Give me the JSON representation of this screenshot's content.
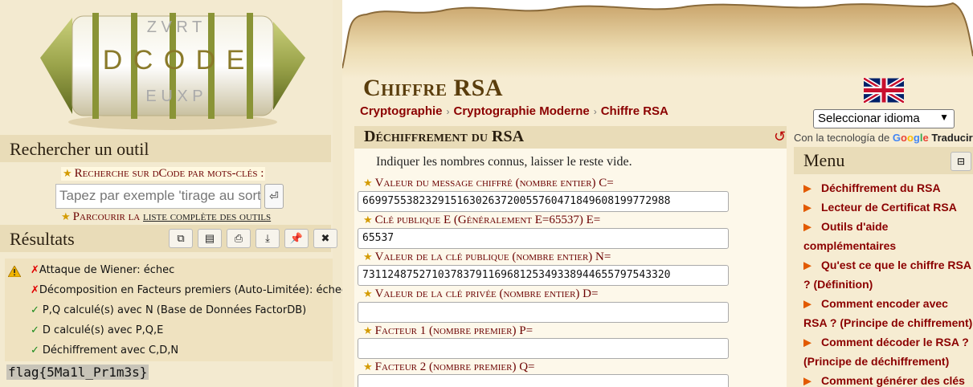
{
  "logo": {
    "letters_row1": "Z V R T",
    "letters_row2": "D C O D E",
    "letters_row3": "E U X P"
  },
  "left": {
    "search_title": "Rechercher un outil",
    "keyword_search": "Recherche sur dCode par mots-clés :",
    "search_placeholder": "Tapez par exemple 'tirage au sort'",
    "search_button": "⏎",
    "browse_prefix": "Parcourir la ",
    "browse_link": "liste complète des outils",
    "results_title": "Résultats",
    "results": [
      {
        "mark": "✗",
        "text": "Attaque de Wiener: échec"
      },
      {
        "mark": "✗",
        "text": "Décomposition en Facteurs premiers (Auto-Limitée): échec"
      },
      {
        "mark": "✓",
        "text": "P,Q calculé(s) avec N (Base de Données FactorDB)"
      },
      {
        "mark": "✓",
        "text": "D calculé(s) avec P,Q,E"
      },
      {
        "mark": "✓",
        "text": "Déchiffrement avec C,D,N"
      }
    ],
    "flag_output": "flag{5Ma1l_Pr1m3s}",
    "tool_icons": [
      "copy-icon",
      "save-icon",
      "print-icon",
      "download-icon",
      "pin-icon",
      "close-icon"
    ]
  },
  "main": {
    "title": "Chiffre RSA",
    "breadcrumb": [
      "Cryptographie",
      "Cryptographie Moderne",
      "Chiffre RSA"
    ],
    "panel_title": "Déchiffrement du RSA",
    "intro": "Indiquer les nombres connus, laisser le reste vide.",
    "fields": [
      {
        "label": "Valeur du message chiffré (nombre entier) C=",
        "value": "6699755382329151630263720055760471849608199772988"
      },
      {
        "label": "Clé publique E (Généralement E=65537) E=",
        "value": "65537"
      },
      {
        "label": "Valeur de la clé publique (nombre entier) N=",
        "value": "7311248752710378379116968125349338944655797543320"
      },
      {
        "label": "Valeur de la clé privée (nombre entier) D=",
        "value": ""
      },
      {
        "label": "Facteur 1 (nombre premier) P=",
        "value": ""
      },
      {
        "label": "Facteur 2 (nombre premier) Q=",
        "value": ""
      }
    ]
  },
  "right": {
    "language_select": "Seleccionar idioma",
    "powered_by": "Con la tecnología de",
    "google_letters": [
      "G",
      "o",
      "o",
      "g",
      "l",
      "e"
    ],
    "translate": "Traducir",
    "menu_title": "Menu",
    "menu_toggle": "⊟",
    "menu_items": [
      "Déchiffrement du RSA",
      "Lecteur de Certificat RSA",
      "Outils d'aide complémentaires",
      "Qu'est ce que le chiffre RSA ? (Définition)",
      "Comment encoder avec RSA ? (Principe de chiffrement)",
      "Comment décoder le RSA ? (Principe de déchiffrement)",
      "Comment générer des clés"
    ]
  }
}
